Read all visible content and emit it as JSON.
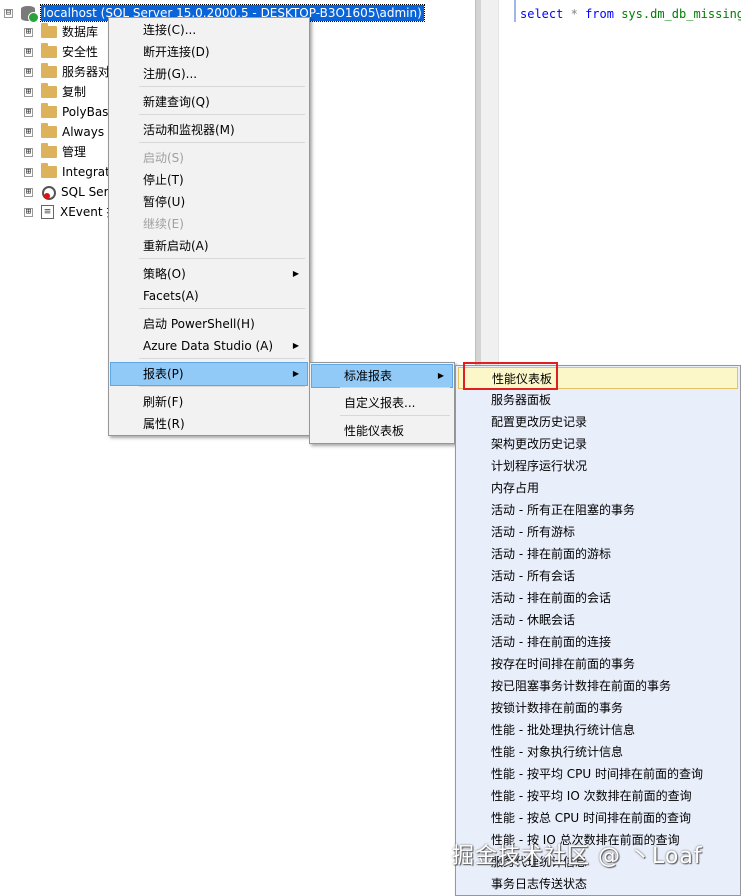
{
  "explorer": {
    "root": {
      "expander": "⊟",
      "label": "localhost (SQL Server 15.0.2000.5 - DESKTOP-B3O1605\\admin)"
    },
    "nodes": [
      {
        "label": "数据库",
        "icon": "folder-icon"
      },
      {
        "label": "安全性",
        "icon": "folder-icon"
      },
      {
        "label": "服务器对",
        "icon": "folder-icon"
      },
      {
        "label": "复制",
        "icon": "folder-icon"
      },
      {
        "label": "PolyBase",
        "icon": "folder-icon"
      },
      {
        "label": "Always O",
        "icon": "folder-icon"
      },
      {
        "label": "管理",
        "icon": "folder-icon"
      },
      {
        "label": "Integrat",
        "icon": "folder-icon"
      },
      {
        "label": "SQL Ser",
        "icon": "sql-agent-icon"
      },
      {
        "label": "XEvent 探",
        "icon": "xevent-icon"
      }
    ],
    "expander": "⊞"
  },
  "editor": {
    "code_keyword": "select",
    "code_star": "*",
    "code_from": "from",
    "code_object": "sys.dm_db_missing_"
  },
  "context_menu": {
    "items": [
      {
        "label": "连接(C)...",
        "enabled": true
      },
      {
        "label": "断开连接(D)",
        "enabled": true
      },
      {
        "label": "注册(G)...",
        "enabled": true
      },
      {
        "label": "新建查询(Q)",
        "enabled": true
      },
      {
        "label": "活动和监视器(M)",
        "enabled": true
      },
      {
        "label": "启动(S)",
        "enabled": false
      },
      {
        "label": "停止(T)",
        "enabled": true
      },
      {
        "label": "暂停(U)",
        "enabled": true
      },
      {
        "label": "继续(E)",
        "enabled": false
      },
      {
        "label": "重新启动(A)",
        "enabled": true
      },
      {
        "label": "策略(O)",
        "enabled": true,
        "submenu": true
      },
      {
        "label": "Facets(A)",
        "enabled": true
      },
      {
        "label": "启动 PowerShell(H)",
        "enabled": true
      },
      {
        "label": "Azure Data Studio (A)",
        "enabled": true,
        "submenu": true
      },
      {
        "label": "报表(P)",
        "enabled": true,
        "submenu": true,
        "highlighted": true
      },
      {
        "label": "刷新(F)",
        "enabled": true
      },
      {
        "label": "属性(R)",
        "enabled": true
      }
    ],
    "submenu_arrow": "▶"
  },
  "reports_menu": {
    "items": [
      {
        "label": "标准报表",
        "submenu": true,
        "highlighted": true
      },
      {
        "label": "自定义报表..."
      },
      {
        "label": "性能仪表板"
      }
    ]
  },
  "standard_reports_menu": {
    "items": [
      "性能仪表板",
      "服务器面板",
      "配置更改历史记录",
      "架构更改历史记录",
      "计划程序运行状况",
      "内存占用",
      "活动 - 所有正在阻塞的事务",
      "活动 - 所有游标",
      "活动 - 排在前面的游标",
      "活动 - 所有会话",
      "活动 - 排在前面的会话",
      "活动 - 休眠会话",
      "活动 - 排在前面的连接",
      "按存在时间排在前面的事务",
      "按已阻塞事务计数排在前面的事务",
      "按锁计数排在前面的事务",
      "性能 - 批处理执行统计信息",
      "性能 - 对象执行统计信息",
      "性能 - 按平均 CPU 时间排在前面的查询",
      "性能 - 按平均 IO 次数排在前面的查询",
      "性能 - 按总 CPU 时间排在前面的查询",
      "性能 - 按 IO 总次数排在前面的查询",
      "服务代理统计信息",
      "事务日志传送状态"
    ]
  },
  "watermark": "掘金技术社区 @ 丶Loaf",
  "colors": {
    "selection": "#0a64d8",
    "menu_highlight": "#91c9f7",
    "highlight_box": "#e02020"
  }
}
